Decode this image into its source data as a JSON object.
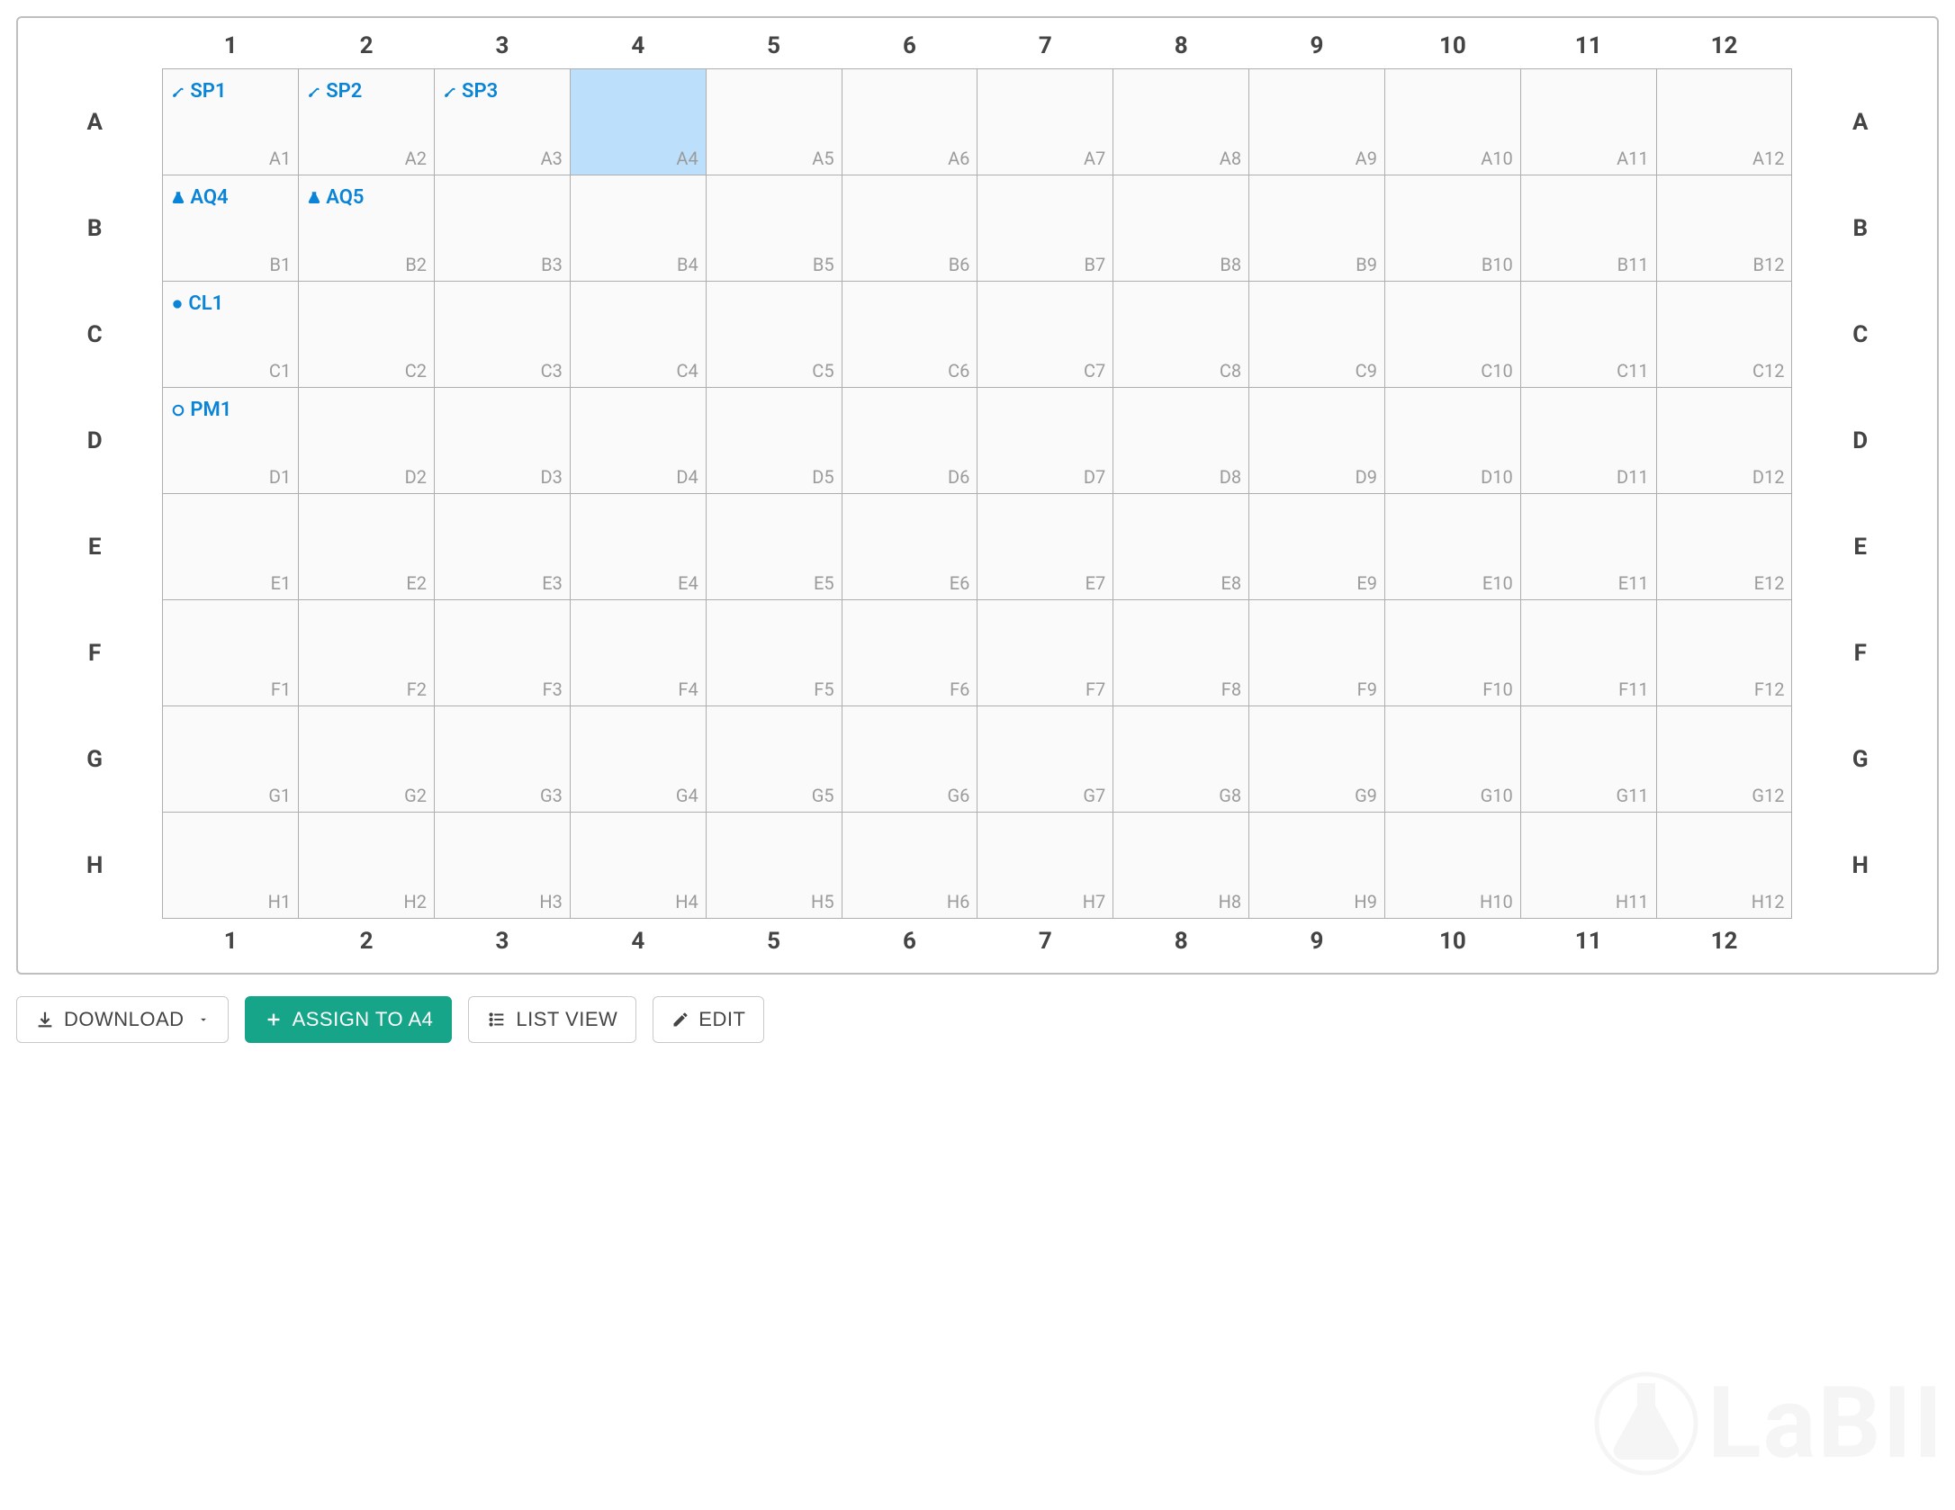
{
  "plate": {
    "columns": [
      "1",
      "2",
      "3",
      "4",
      "5",
      "6",
      "7",
      "8",
      "9",
      "10",
      "11",
      "12"
    ],
    "rows": [
      "A",
      "B",
      "C",
      "D",
      "E",
      "F",
      "G",
      "H"
    ],
    "selected": "A4",
    "wells": {
      "A1": {
        "label": "SP1",
        "iconType": "sample"
      },
      "A2": {
        "label": "SP2",
        "iconType": "sample"
      },
      "A3": {
        "label": "SP3",
        "iconType": "sample"
      },
      "B1": {
        "label": "AQ4",
        "iconType": "aliquot"
      },
      "B2": {
        "label": "AQ5",
        "iconType": "aliquot"
      },
      "C1": {
        "label": "CL1",
        "iconType": "cell"
      },
      "D1": {
        "label": "PM1",
        "iconType": "plasmid"
      }
    }
  },
  "toolbar": {
    "download_label": "DOWNLOAD",
    "assign_label": "ASSIGN TO A4",
    "listview_label": "LIST VIEW",
    "edit_label": "EDIT"
  },
  "watermark": "LaBII",
  "colors": {
    "accent": "#0a84d6",
    "primary_button": "#17a589",
    "selected_well": "#bcdffb"
  }
}
